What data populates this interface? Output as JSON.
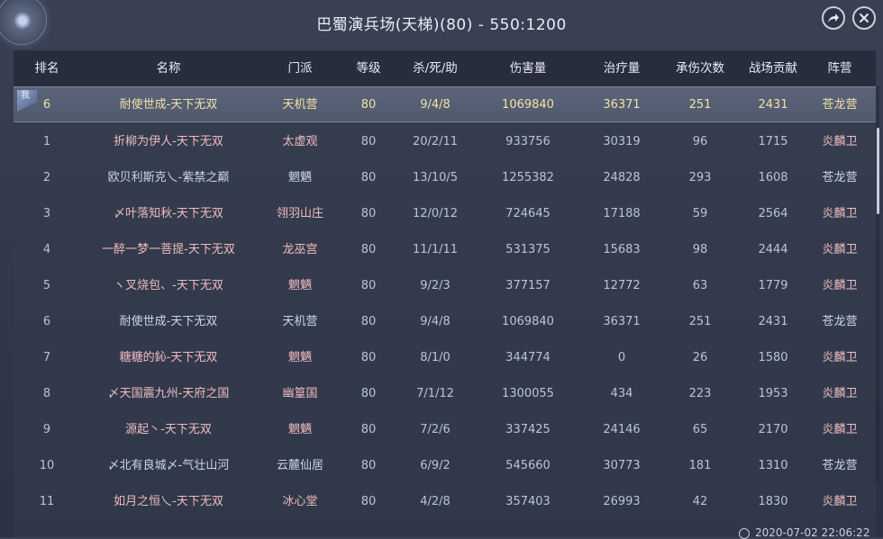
{
  "title": "巴蜀演兵场(天梯)(80) - 550:1200",
  "icons": {
    "share": "share-arrow-icon",
    "close": "close-icon",
    "clock": "clock-icon",
    "self_marker": "self-marker-icon"
  },
  "colors": {
    "camp_red_text": "#f1bcc0",
    "camp_blue_text": "#c9d6f0",
    "highlight_text": "#efe3a6"
  },
  "self_marker_label": "我",
  "headers": [
    "排名",
    "名称",
    "门派",
    "等级",
    "杀/死/助",
    "伤害量",
    "治疗量",
    "承伤次数",
    "战场贡献",
    "阵营"
  ],
  "self_row": {
    "rank": "6",
    "name": "耐使世成-天下无双",
    "sect": "天机营",
    "level": "80",
    "kda": "9/4/8",
    "damage": "1069840",
    "healing": "36371",
    "hits_taken": "251",
    "contribution": "2431",
    "camp": "苍龙营"
  },
  "rows": [
    {
      "rank": "1",
      "name": "折柳为伊人-天下无双",
      "sect": "太虚观",
      "level": "80",
      "kda": "20/2/11",
      "damage": "933756",
      "healing": "30319",
      "hits_taken": "96",
      "contribution": "1715",
      "camp": "炎麟卫"
    },
    {
      "rank": "2",
      "name": "欧贝利斯克乀-紫禁之巅",
      "sect": "魍魉",
      "level": "80",
      "kda": "13/10/5",
      "damage": "1255382",
      "healing": "24828",
      "hits_taken": "293",
      "contribution": "1608",
      "camp": "苍龙营"
    },
    {
      "rank": "3",
      "name": "〆叶落知秋-天下无双",
      "sect": "翎羽山庄",
      "level": "80",
      "kda": "12/0/12",
      "damage": "724645",
      "healing": "17188",
      "hits_taken": "59",
      "contribution": "2564",
      "camp": "炎麟卫"
    },
    {
      "rank": "4",
      "name": "一醉一梦一菩提-天下无双",
      "sect": "龙巫宫",
      "level": "80",
      "kda": "11/1/11",
      "damage": "531375",
      "healing": "15683",
      "hits_taken": "98",
      "contribution": "2444",
      "camp": "炎麟卫"
    },
    {
      "rank": "5",
      "name": "ヽ叉烧包、-天下无双",
      "sect": "魍魉",
      "level": "80",
      "kda": "9/2/3",
      "damage": "377157",
      "healing": "12772",
      "hits_taken": "63",
      "contribution": "1779",
      "camp": "炎麟卫"
    },
    {
      "rank": "6",
      "name": "耐使世成-天下无双",
      "sect": "天机营",
      "level": "80",
      "kda": "9/4/8",
      "damage": "1069840",
      "healing": "36371",
      "hits_taken": "251",
      "contribution": "2431",
      "camp": "苍龙营"
    },
    {
      "rank": "7",
      "name": "糖糖的鈊-天下无双",
      "sect": "魍魉",
      "level": "80",
      "kda": "8/1/0",
      "damage": "344774",
      "healing": "0",
      "hits_taken": "26",
      "contribution": "1580",
      "camp": "炎麟卫"
    },
    {
      "rank": "8",
      "name": "〆天国震九州-天府之国",
      "sect": "幽篁国",
      "level": "80",
      "kda": "7/1/12",
      "damage": "1300055",
      "healing": "434",
      "hits_taken": "223",
      "contribution": "1953",
      "camp": "炎麟卫"
    },
    {
      "rank": "9",
      "name": "源起丶-天下无双",
      "sect": "魍魉",
      "level": "80",
      "kda": "7/2/6",
      "damage": "337425",
      "healing": "24146",
      "hits_taken": "65",
      "contribution": "2170",
      "camp": "炎麟卫"
    },
    {
      "rank": "10",
      "name": "〆北有良城〆-气壮山河",
      "sect": "云麓仙居",
      "level": "80",
      "kda": "6/9/2",
      "damage": "545660",
      "healing": "30773",
      "hits_taken": "181",
      "contribution": "1310",
      "camp": "苍龙营"
    },
    {
      "rank": "11",
      "name": "如月之恒乀-天下无双",
      "sect": "冰心堂",
      "level": "80",
      "kda": "4/2/8",
      "damage": "357403",
      "healing": "26993",
      "hits_taken": "42",
      "contribution": "1830",
      "camp": "炎麟卫"
    }
  ],
  "timestamp": "2020-07-02 22:06:22"
}
